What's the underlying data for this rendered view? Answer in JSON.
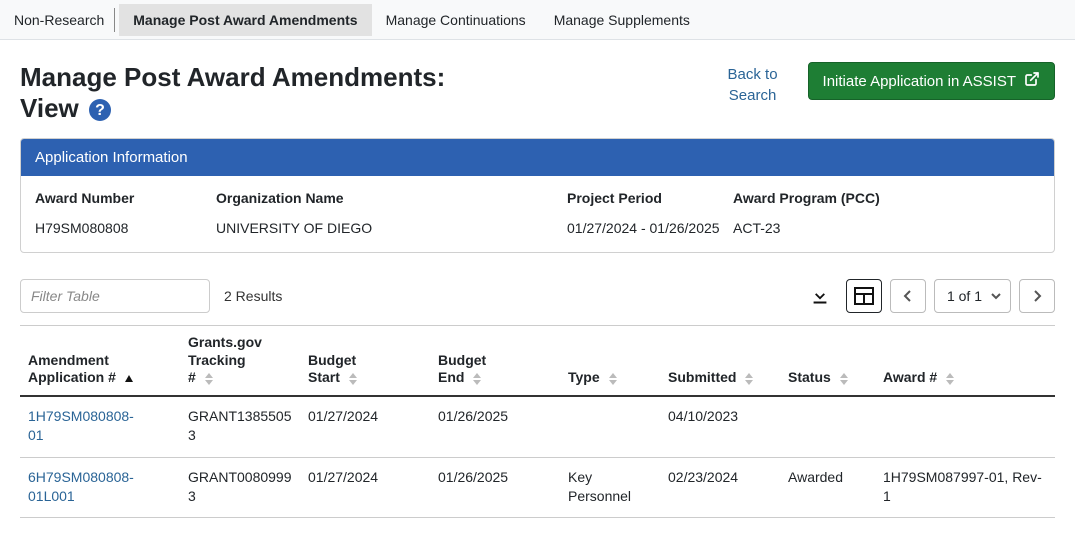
{
  "nav": {
    "non_research": "Non-Research",
    "tabs": [
      {
        "label": "Manage Post Award Amendments",
        "active": true
      },
      {
        "label": "Manage Continuations",
        "active": false
      },
      {
        "label": "Manage Supplements",
        "active": false
      }
    ]
  },
  "title": {
    "line1": "Manage Post Award Amendments:",
    "line2": "View"
  },
  "actions": {
    "back_line1": "Back to",
    "back_line2": "Search",
    "initiate_label": "Initiate Application in ASSIST"
  },
  "panel": {
    "header": "Application Information",
    "award_number_label": "Award Number",
    "org_label": "Organization Name",
    "project_period_label": "Project Period",
    "award_program_label": "Award Program (PCC)",
    "award_number": "H79SM080808",
    "org_name": "UNIVERSITY OF DIEGO",
    "project_period": "01/27/2024 - 01/26/2025",
    "award_program": "ACT-23"
  },
  "table_bar": {
    "filter_placeholder": "Filter Table",
    "results_text": "2 Results",
    "page_label": "1 of 1"
  },
  "table": {
    "colA": "Amendment",
    "colB": "Application #",
    "colC": "Grants.gov",
    "colD": "Tracking",
    "colE": "#",
    "colF": "Budget",
    "colG": "Start",
    "colH": "End",
    "colI": "Type",
    "colJ": "Submitted",
    "colK": "Status",
    "colL": "Award #",
    "rows": [
      {
        "appA": "1H79SM080808-",
        "appB": "01",
        "trackA": "GRANT1385505",
        "trackB": "3",
        "bstart": "01/27/2024",
        "bend": "01/26/2025",
        "type": "",
        "submitted": "04/10/2023",
        "status": "",
        "award": ""
      },
      {
        "appA": "6H79SM080808-",
        "appB": "01L001",
        "trackA": "GRANT0080999",
        "trackB": "3",
        "bstart": "01/27/2024",
        "bend": "01/26/2025",
        "type": "Key Personnel",
        "submitted": "02/23/2024",
        "status": "Awarded",
        "award": "1H79SM087997-01, Rev-1"
      }
    ]
  }
}
